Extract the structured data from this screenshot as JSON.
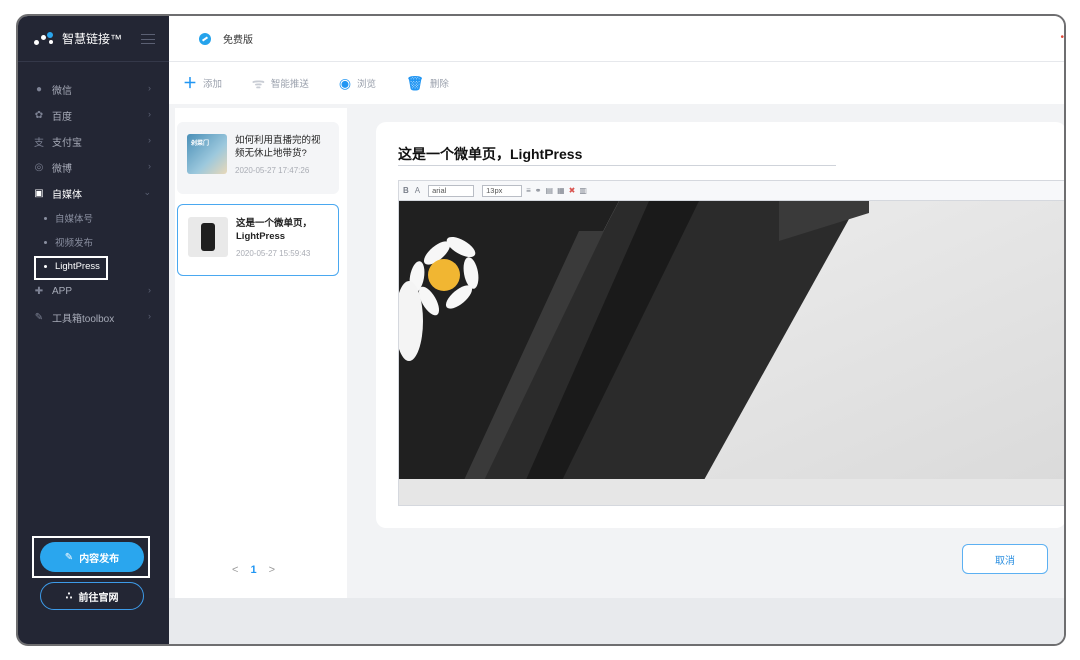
{
  "app": {
    "brand": "智慧链接™",
    "edition": "免费版",
    "accent_color": "#2196f3",
    "sidebar_bg": "#232634"
  },
  "sidebar": {
    "items": [
      {
        "label": "微信",
        "icon": "wechat-icon"
      },
      {
        "label": "百度",
        "icon": "baidu-paw-icon"
      },
      {
        "label": "支付宝",
        "icon": "alipay-icon"
      },
      {
        "label": "微博",
        "icon": "weibo-icon"
      },
      {
        "label": "自媒体",
        "icon": "media-icon",
        "expanded": true
      },
      {
        "label": "APP",
        "icon": "android-icon"
      },
      {
        "label": "工具箱toolbox",
        "icon": "wrench-icon"
      }
    ],
    "sub_items": [
      {
        "label": "自媒体号"
      },
      {
        "label": "视频发布"
      },
      {
        "label": "LightPress",
        "active": true
      }
    ],
    "publish_label": "内容发布",
    "site_label": "前往官网"
  },
  "toolbar": {
    "add_label": "添加",
    "push_label": "智能推送",
    "preview_label": "浏览",
    "delete_label": "删除"
  },
  "articles": [
    {
      "title": "如何利用直播完的视频无休止地带货?",
      "date": "2020-05-27 17:47:26",
      "thumb_text": "剁菜门"
    },
    {
      "title": "这是一个微单页，LightPress",
      "date": "2020-05-27 15:59:43",
      "selected": true
    }
  ],
  "pagination": {
    "prev": "<",
    "page": "1",
    "next": ">"
  },
  "editor": {
    "title": "这是一个微单页，LightPress",
    "toolbar": {
      "bold": "B",
      "font_color": "A",
      "font_family": "arial",
      "font_size": "13px"
    }
  },
  "actions": {
    "cancel_label": "取消"
  }
}
